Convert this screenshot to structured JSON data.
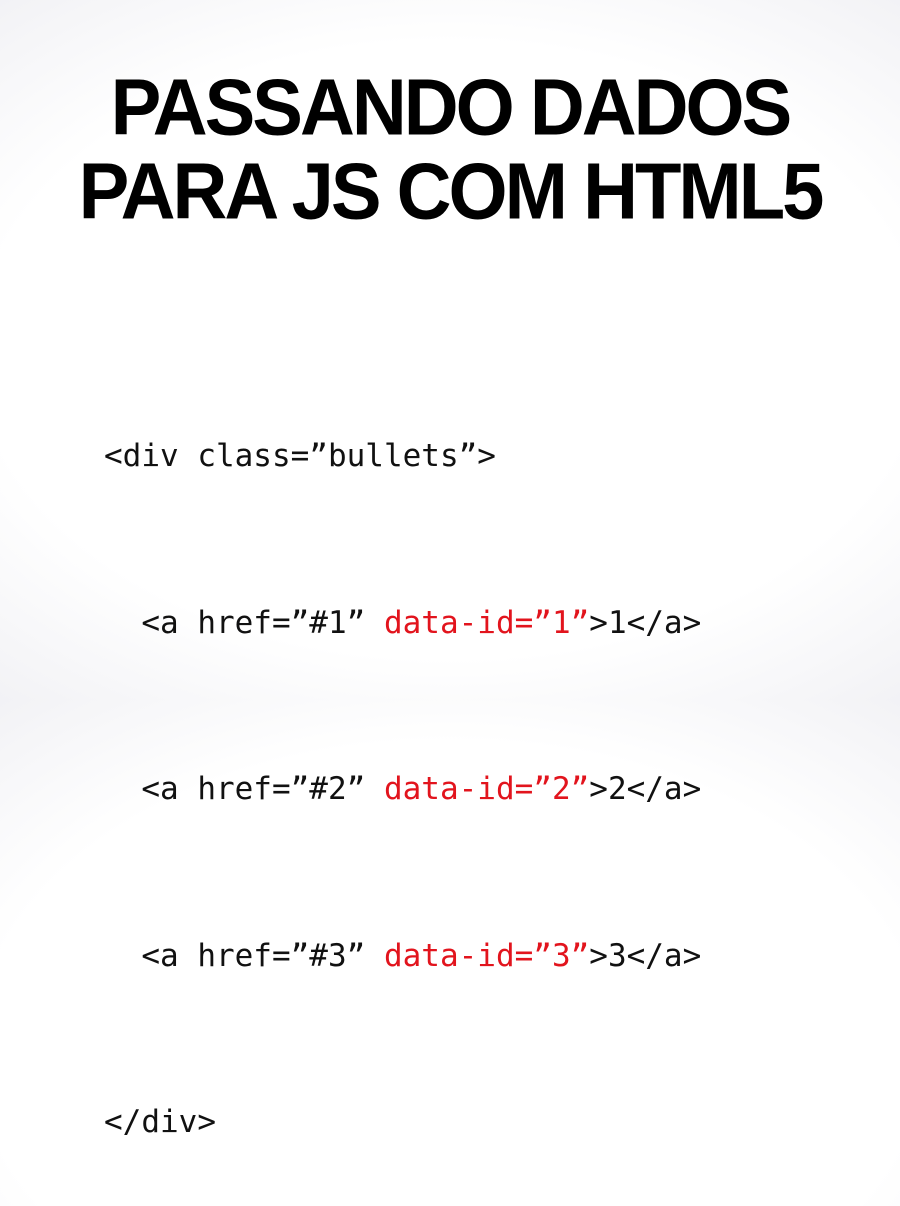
{
  "title": {
    "line1": "PASSANDO DADOS",
    "line2": "PARA JS COM HTML5"
  },
  "code": {
    "open_div": "<div class=”bullets”>",
    "links": [
      {
        "prefix": "  <a href=”#1” ",
        "attr": "data-id=”1”",
        "suffix": ">1</a>"
      },
      {
        "prefix": "  <a href=”#2” ",
        "attr": "data-id=”2”",
        "suffix": ">2</a>"
      },
      {
        "prefix": "  <a href=”#3” ",
        "attr": "data-id=”3”",
        "suffix": ">3</a>"
      }
    ],
    "close_div": "</div>"
  },
  "colors": {
    "title": "#000000",
    "code_text": "#111111",
    "highlight_attr": "#e2141d"
  }
}
